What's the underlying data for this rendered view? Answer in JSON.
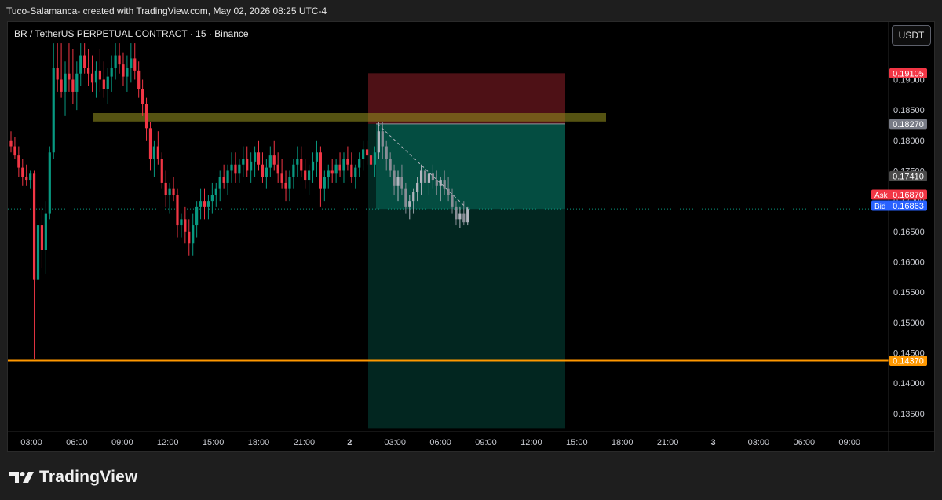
{
  "caption": "Tuco-Salamanca- created with TradingView.com, May 02, 2026 08:25 UTC-4",
  "chart_title": "BR / TetherUS PERPETUAL CONTRACT · 15 · Binance",
  "currency_button": "USDT",
  "brand": "TradingView",
  "colors": {
    "up": "#089981",
    "down": "#f23645",
    "background": "#000000",
    "orange": "#ff9800",
    "ask": "#f23645",
    "bid": "#2962ff"
  },
  "chart_data": {
    "type": "candlestick",
    "title": "BR / TetherUS PERPETUAL CONTRACT · 15 · Binance",
    "ylim": [
      0.132,
      0.1995
    ],
    "y_ticks": [
      "0.19000",
      "0.18500",
      "0.18000",
      "0.17500",
      "0.17000",
      "0.16500",
      "0.16000",
      "0.15500",
      "0.15000",
      "0.14500",
      "0.14000",
      "0.13500"
    ],
    "x_ticks": [
      "03:00",
      "06:00",
      "09:00",
      "12:00",
      "15:00",
      "18:00",
      "21:00",
      "2",
      "03:00",
      "06:00",
      "09:00",
      "12:00",
      "15:00",
      "18:00",
      "21:00",
      "3",
      "03:00",
      "06:00",
      "09:00"
    ],
    "price_labels": [
      {
        "label": "0.19105",
        "value": 0.19105,
        "color": "#f23645"
      },
      {
        "label": "0.18270",
        "value": 0.1827,
        "color": "#787b86"
      },
      {
        "label": "0.17410",
        "value": 0.1741,
        "color": "#4a4a4a"
      },
      {
        "label": "0.14370",
        "value": 0.1437,
        "color": "#ff9800"
      }
    ],
    "ask": {
      "tag": "Ask",
      "label": "0.16870",
      "value": 0.1687
    },
    "bid": {
      "tag": "Bid",
      "label": "0.16863",
      "value": 0.16863
    },
    "horizontal_line": 0.1437,
    "resistance_zone": [
      0.1831,
      0.1845
    ],
    "position": {
      "type": "short",
      "entry": 0.1827,
      "stop": 0.19105,
      "target": 0.1326,
      "current": 0.1687
    },
    "candles": [
      [
        0.18,
        0.1815,
        0.178,
        0.179
      ],
      [
        0.179,
        0.1805,
        0.177,
        0.1775
      ],
      [
        0.1775,
        0.179,
        0.174,
        0.1755
      ],
      [
        0.1755,
        0.177,
        0.1725,
        0.174
      ],
      [
        0.174,
        0.176,
        0.1725,
        0.1735
      ],
      [
        0.1735,
        0.175,
        0.172,
        0.1745
      ],
      [
        0.1745,
        0.175,
        0.144,
        0.157
      ],
      [
        0.157,
        0.168,
        0.155,
        0.166
      ],
      [
        0.166,
        0.169,
        0.159,
        0.162
      ],
      [
        0.162,
        0.17,
        0.158,
        0.168
      ],
      [
        0.168,
        0.179,
        0.167,
        0.178
      ],
      [
        0.178,
        0.196,
        0.177,
        0.192
      ],
      [
        0.192,
        0.196,
        0.188,
        0.19
      ],
      [
        0.19,
        0.196,
        0.187,
        0.188
      ],
      [
        0.188,
        0.193,
        0.184,
        0.191
      ],
      [
        0.191,
        0.196,
        0.188,
        0.19
      ],
      [
        0.19,
        0.195,
        0.186,
        0.188
      ],
      [
        0.188,
        0.193,
        0.185,
        0.191
      ],
      [
        0.191,
        0.196,
        0.189,
        0.194
      ],
      [
        0.194,
        0.196,
        0.191,
        0.192
      ],
      [
        0.192,
        0.195,
        0.189,
        0.191
      ],
      [
        0.191,
        0.194,
        0.188,
        0.1895
      ],
      [
        0.1895,
        0.193,
        0.187,
        0.1915
      ],
      [
        0.1915,
        0.195,
        0.188,
        0.19
      ],
      [
        0.19,
        0.193,
        0.187,
        0.1885
      ],
      [
        0.1885,
        0.192,
        0.186,
        0.1905
      ],
      [
        0.1905,
        0.194,
        0.188,
        0.192
      ],
      [
        0.192,
        0.196,
        0.19,
        0.194
      ],
      [
        0.194,
        0.196,
        0.191,
        0.1925
      ],
      [
        0.1925,
        0.1945,
        0.189,
        0.1905
      ],
      [
        0.1905,
        0.194,
        0.188,
        0.192
      ],
      [
        0.192,
        0.196,
        0.1895,
        0.1935
      ],
      [
        0.1935,
        0.196,
        0.19,
        0.1915
      ],
      [
        0.1915,
        0.193,
        0.187,
        0.1885
      ],
      [
        0.1885,
        0.19,
        0.184,
        0.186
      ],
      [
        0.186,
        0.187,
        0.18,
        0.182
      ],
      [
        0.182,
        0.183,
        0.175,
        0.177
      ],
      [
        0.177,
        0.18,
        0.174,
        0.179
      ],
      [
        0.179,
        0.1815,
        0.176,
        0.177
      ],
      [
        0.177,
        0.178,
        0.172,
        0.173
      ],
      [
        0.173,
        0.175,
        0.169,
        0.171
      ],
      [
        0.171,
        0.173,
        0.168,
        0.172
      ],
      [
        0.172,
        0.174,
        0.17,
        0.171
      ],
      [
        0.171,
        0.172,
        0.164,
        0.166
      ],
      [
        0.166,
        0.168,
        0.164,
        0.167
      ],
      [
        0.167,
        0.169,
        0.163,
        0.165
      ],
      [
        0.165,
        0.167,
        0.161,
        0.163
      ],
      [
        0.163,
        0.168,
        0.161,
        0.166
      ],
      [
        0.166,
        0.17,
        0.164,
        0.169
      ],
      [
        0.169,
        0.172,
        0.167,
        0.17
      ],
      [
        0.17,
        0.172,
        0.167,
        0.169
      ],
      [
        0.169,
        0.171,
        0.167,
        0.17
      ],
      [
        0.17,
        0.173,
        0.168,
        0.171
      ],
      [
        0.171,
        0.173,
        0.169,
        0.172
      ],
      [
        0.172,
        0.175,
        0.17,
        0.174
      ],
      [
        0.174,
        0.176,
        0.172,
        0.173
      ],
      [
        0.173,
        0.176,
        0.171,
        0.175
      ],
      [
        0.175,
        0.178,
        0.173,
        0.176
      ],
      [
        0.176,
        0.178,
        0.173,
        0.1745
      ],
      [
        0.1745,
        0.177,
        0.173,
        0.176
      ],
      [
        0.176,
        0.179,
        0.174,
        0.177
      ],
      [
        0.177,
        0.179,
        0.174,
        0.175
      ],
      [
        0.175,
        0.178,
        0.173,
        0.1765
      ],
      [
        0.1765,
        0.179,
        0.174,
        0.178
      ],
      [
        0.178,
        0.18,
        0.175,
        0.176
      ],
      [
        0.176,
        0.178,
        0.173,
        0.174
      ],
      [
        0.174,
        0.177,
        0.172,
        0.1755
      ],
      [
        0.1755,
        0.179,
        0.174,
        0.1775
      ],
      [
        0.1775,
        0.18,
        0.175,
        0.176
      ],
      [
        0.176,
        0.178,
        0.173,
        0.1745
      ],
      [
        0.1745,
        0.177,
        0.172,
        0.173
      ],
      [
        0.173,
        0.175,
        0.17,
        0.172
      ],
      [
        0.172,
        0.175,
        0.17,
        0.174
      ],
      [
        0.174,
        0.177,
        0.172,
        0.176
      ],
      [
        0.176,
        0.179,
        0.174,
        0.177
      ],
      [
        0.177,
        0.179,
        0.174,
        0.175
      ],
      [
        0.175,
        0.177,
        0.172,
        0.1735
      ],
      [
        0.1735,
        0.176,
        0.171,
        0.175
      ],
      [
        0.175,
        0.178,
        0.173,
        0.1765
      ],
      [
        0.1765,
        0.18,
        0.174,
        0.178
      ],
      [
        0.178,
        0.179,
        0.169,
        0.172
      ],
      [
        0.172,
        0.175,
        0.17,
        0.174
      ],
      [
        0.174,
        0.176,
        0.172,
        0.175
      ],
      [
        0.175,
        0.177,
        0.173,
        0.1745
      ],
      [
        0.1745,
        0.177,
        0.173,
        0.176
      ],
      [
        0.176,
        0.178,
        0.174,
        0.175
      ],
      [
        0.175,
        0.178,
        0.173,
        0.177
      ],
      [
        0.177,
        0.179,
        0.175,
        0.176
      ],
      [
        0.176,
        0.178,
        0.173,
        0.174
      ],
      [
        0.174,
        0.176,
        0.172,
        0.1755
      ],
      [
        0.1755,
        0.178,
        0.174,
        0.177
      ],
      [
        0.177,
        0.18,
        0.175,
        0.1785
      ],
      [
        0.1785,
        0.18,
        0.176,
        0.1775
      ],
      [
        0.1775,
        0.179,
        0.175,
        0.176
      ],
      [
        0.176,
        0.179,
        0.174,
        0.178
      ],
      [
        0.178,
        0.183,
        0.177,
        0.1815
      ],
      [
        0.1815,
        0.183,
        0.177,
        0.179
      ],
      [
        0.179,
        0.18,
        0.175,
        0.177
      ],
      [
        0.177,
        0.178,
        0.174,
        0.175
      ],
      [
        0.175,
        0.176,
        0.171,
        0.1725
      ],
      [
        0.1725,
        0.175,
        0.17,
        0.174
      ],
      [
        0.174,
        0.176,
        0.171,
        0.172
      ],
      [
        0.172,
        0.173,
        0.168,
        0.169
      ],
      [
        0.169,
        0.171,
        0.167,
        0.17
      ],
      [
        0.17,
        0.172,
        0.168,
        0.1715
      ],
      [
        0.1715,
        0.174,
        0.17,
        0.173
      ],
      [
        0.173,
        0.176,
        0.171,
        0.175
      ],
      [
        0.175,
        0.176,
        0.172,
        0.173
      ],
      [
        0.173,
        0.175,
        0.171,
        0.1745
      ],
      [
        0.1745,
        0.176,
        0.172,
        0.1735
      ],
      [
        0.1735,
        0.175,
        0.171,
        0.1725
      ],
      [
        0.1725,
        0.174,
        0.17,
        0.1735
      ],
      [
        0.1735,
        0.175,
        0.171,
        0.172
      ],
      [
        0.172,
        0.174,
        0.17,
        0.171
      ],
      [
        0.171,
        0.172,
        0.168,
        0.169
      ],
      [
        0.169,
        0.17,
        0.166,
        0.167
      ],
      [
        0.167,
        0.169,
        0.1655,
        0.168
      ],
      [
        0.168,
        0.17,
        0.166,
        0.1665
      ],
      [
        0.1665,
        0.169,
        0.166,
        0.1687
      ]
    ]
  }
}
